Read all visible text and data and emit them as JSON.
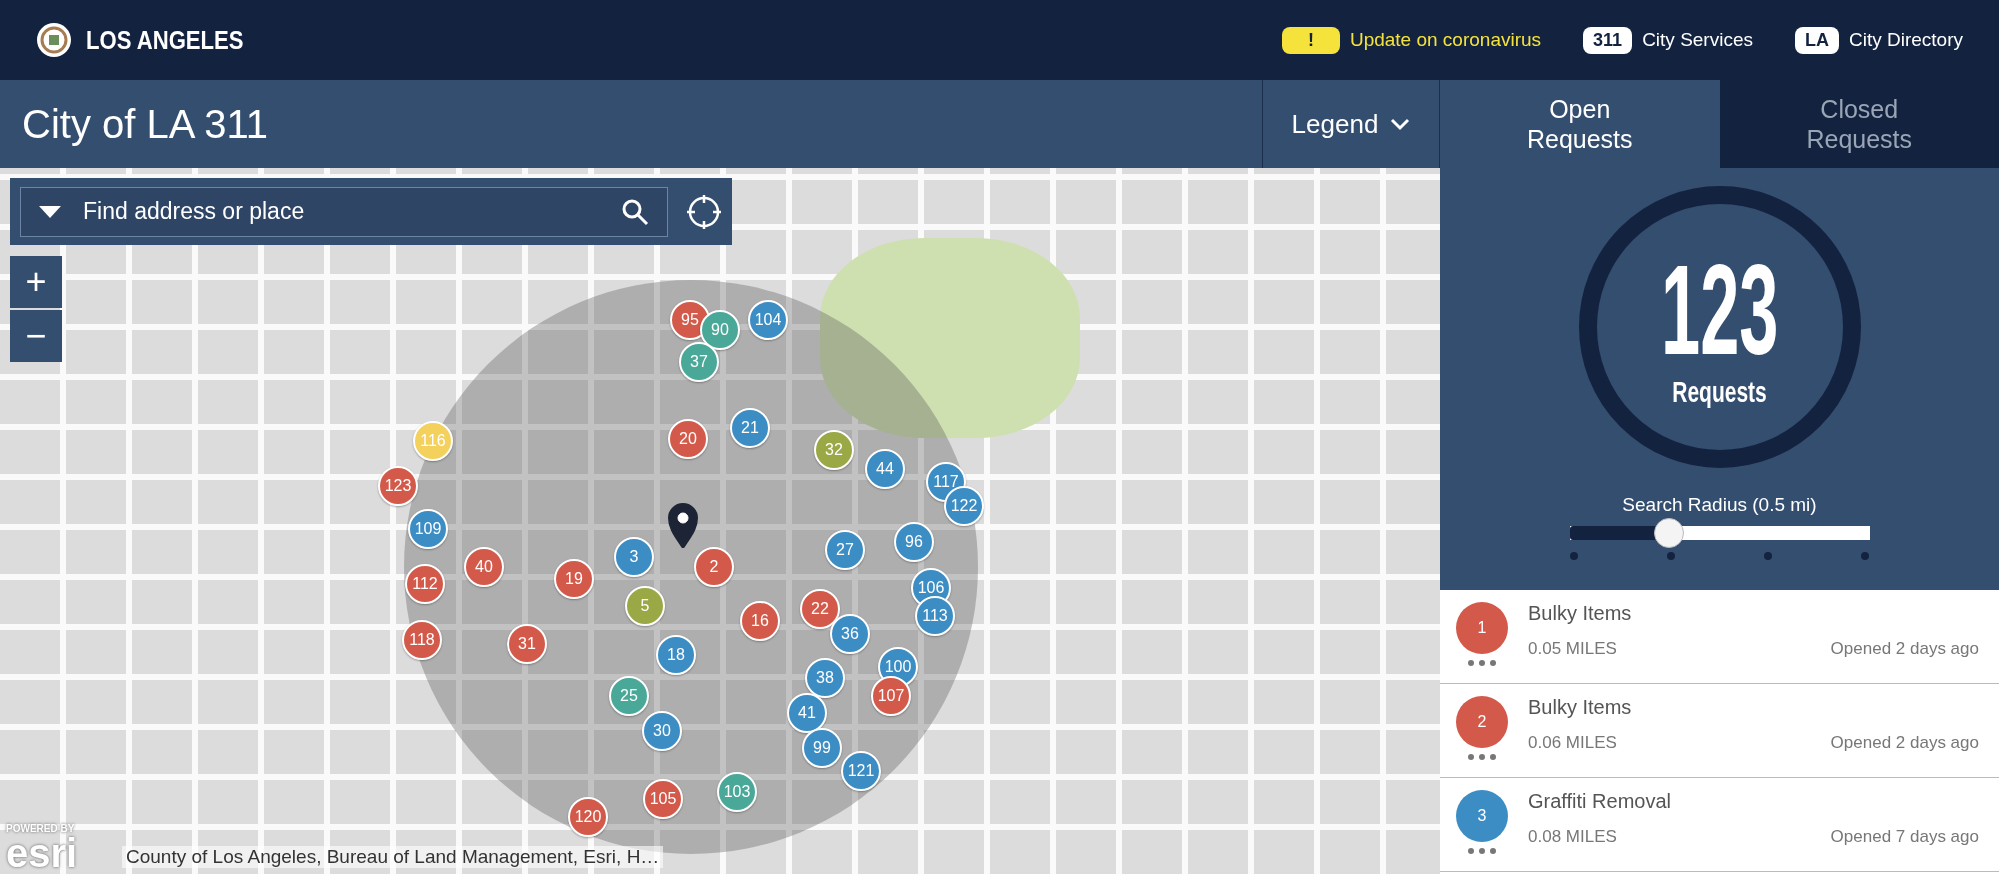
{
  "header": {
    "brand": "LOS ANGELES",
    "alert": {
      "badge": "!",
      "text": "Update on coronavirus"
    },
    "links": [
      {
        "badge": "311",
        "text": "City Services"
      },
      {
        "badge": "LA",
        "text": "City Directory"
      }
    ]
  },
  "title_bar": {
    "title": "City of LA 311",
    "legend": "Legend"
  },
  "tabs": [
    {
      "label": "Open Requests",
      "selected": true
    },
    {
      "label": "Closed Requests",
      "selected": false
    }
  ],
  "map": {
    "search": {
      "placeholder": "Find address or place"
    },
    "zoom": [
      "+",
      "−"
    ],
    "esri": {
      "powered": "POWERED BY",
      "logo": "esri"
    },
    "attribution": "County of Los Angeles, Bureau of Land Management, Esri, H…",
    "markers": [
      {
        "label": "95",
        "color": "#d35a4a"
      },
      {
        "label": "90",
        "color": "#4aa899"
      },
      {
        "label": "104",
        "color": "#3b8dc4"
      },
      {
        "label": "37",
        "color": "#4aa899"
      },
      {
        "label": "21",
        "color": "#3b8dc4"
      },
      {
        "label": "20",
        "color": "#d35a4a"
      },
      {
        "label": "32",
        "color": "#9aa845"
      },
      {
        "label": "44",
        "color": "#3b8dc4"
      },
      {
        "label": "117",
        "color": "#3b8dc4"
      },
      {
        "label": "122",
        "color": "#3b8dc4"
      },
      {
        "label": "116",
        "color": "#f3d15c"
      },
      {
        "label": "123",
        "color": "#d35a4a"
      },
      {
        "label": "109",
        "color": "#3b8dc4"
      },
      {
        "label": "96",
        "color": "#3b8dc4"
      },
      {
        "label": "27",
        "color": "#3b8dc4"
      },
      {
        "label": "3",
        "color": "#3b8dc4"
      },
      {
        "label": "2",
        "color": "#d35a4a"
      },
      {
        "label": "40",
        "color": "#d35a4a"
      },
      {
        "label": "19",
        "color": "#d35a4a"
      },
      {
        "label": "112",
        "color": "#d35a4a"
      },
      {
        "label": "106",
        "color": "#3b8dc4"
      },
      {
        "label": "5",
        "color": "#9aa845"
      },
      {
        "label": "22",
        "color": "#d35a4a"
      },
      {
        "label": "16",
        "color": "#d35a4a"
      },
      {
        "label": "113",
        "color": "#3b8dc4"
      },
      {
        "label": "118",
        "color": "#d35a4a"
      },
      {
        "label": "31",
        "color": "#d35a4a"
      },
      {
        "label": "36",
        "color": "#3b8dc4"
      },
      {
        "label": "18",
        "color": "#3b8dc4"
      },
      {
        "label": "100",
        "color": "#3b8dc4"
      },
      {
        "label": "38",
        "color": "#3b8dc4"
      },
      {
        "label": "25",
        "color": "#4aa899"
      },
      {
        "label": "107",
        "color": "#d35a4a"
      },
      {
        "label": "41",
        "color": "#3b8dc4"
      },
      {
        "label": "30",
        "color": "#3b8dc4"
      },
      {
        "label": "99",
        "color": "#3b8dc4"
      },
      {
        "label": "121",
        "color": "#3b8dc4"
      },
      {
        "label": "105",
        "color": "#d35a4a"
      },
      {
        "label": "103",
        "color": "#4aa899"
      },
      {
        "label": "120",
        "color": "#d35a4a"
      }
    ]
  },
  "summary": {
    "count": "123",
    "unit": "Requests",
    "radius_label": "Search Radius (0.5 mi)",
    "radius": {
      "level": 0.33
    }
  },
  "requests": [
    {
      "number": "1",
      "color": "#d35a4a",
      "name": "Bulky Items",
      "distance": "0.05 MILES",
      "opened": "Opened 2 days ago"
    },
    {
      "number": "2",
      "color": "#d35a4a",
      "name": "Bulky Items",
      "distance": "0.06 MILES",
      "opened": "Opened 2 days ago"
    },
    {
      "number": "3",
      "color": "#3b8dc4",
      "name": "Graffiti Removal",
      "distance": "0.08 MILES",
      "opened": "Opened 7 days ago"
    }
  ]
}
